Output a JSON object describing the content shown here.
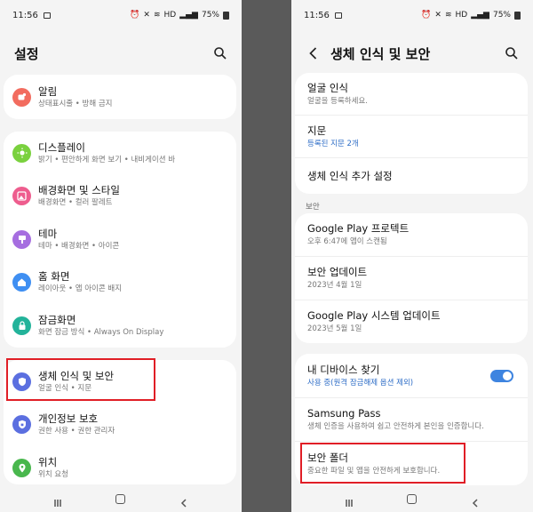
{
  "left": {
    "status": {
      "time": "11:56",
      "battery": "75%",
      "network": "HD"
    },
    "header": {
      "title": "설정"
    },
    "items": [
      {
        "label": "알림",
        "sub": "상태표시줄 • 방해 금지",
        "color": "#f26c5f"
      },
      {
        "label": "디스플레이",
        "sub": "밝기 • 편안하게 화면 보기 • 내비게이션 바",
        "color": "#7ad13e"
      },
      {
        "label": "배경화면 및 스타일",
        "sub": "배경화면 • 컬러 팔레트",
        "color": "#ee5d8e"
      },
      {
        "label": "테마",
        "sub": "테마 • 배경화면 • 아이콘",
        "color": "#a66ee0"
      },
      {
        "label": "홈 화면",
        "sub": "레이아웃 • 앱 아이콘 배지",
        "color": "#3f8ff2"
      },
      {
        "label": "잠금화면",
        "sub": "화면 잠금 방식 • Always On Display",
        "color": "#23b39a"
      },
      {
        "label": "생체 인식 및 보안",
        "sub": "얼굴 인식 • 지문",
        "color": "#5b6fe0"
      },
      {
        "label": "개인정보 보호",
        "sub": "권한 사용 • 권한 관리자",
        "color": "#5b6fe0"
      },
      {
        "label": "위치",
        "sub": "위치 요청",
        "color": "#49b74d"
      }
    ]
  },
  "right": {
    "status": {
      "time": "11:56",
      "battery": "75%",
      "network": "HD"
    },
    "header": {
      "title": "생체 인식 및 보안"
    },
    "group1": [
      {
        "label": "얼굴 인식",
        "sub": "얼굴을 등록하세요."
      },
      {
        "label": "지문",
        "sub": "등록된 지문 2개",
        "sub_color": "blue"
      },
      {
        "label": "생체 인식 추가 설정",
        "sub": ""
      }
    ],
    "section_label": "보안",
    "group2": [
      {
        "label": "Google Play 프로텍트",
        "sub": "오후 6:47에 앱이 스캔됨"
      },
      {
        "label": "보안 업데이트",
        "sub": "2023년 4월 1일"
      },
      {
        "label": "Google Play 시스템 업데이트",
        "sub": "2023년 5월 1일"
      }
    ],
    "group3": [
      {
        "label": "내 디바이스 찾기",
        "sub": "사용 중(원격 잠금해제 옵션 제외)",
        "sub_color": "blue",
        "toggle": true
      },
      {
        "label": "Samsung Pass",
        "sub": "생체 인증을 사용하여 쉽고 안전하게 본인을 인증합니다."
      },
      {
        "label": "보안 폴더",
        "sub": "중요한 파일 및 앱을 안전하게 보호합니다."
      }
    ]
  },
  "colors": {
    "highlight": "#e01e26",
    "accent": "#3e84e0",
    "link": "#2f6ec7"
  }
}
